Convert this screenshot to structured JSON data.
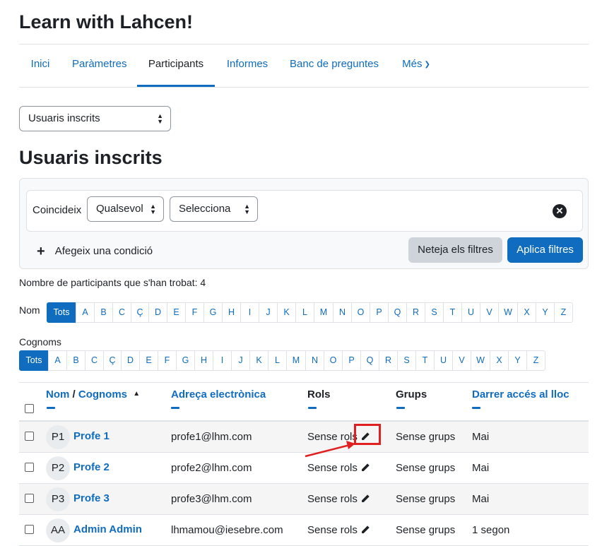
{
  "course_title": "Learn with Lahcen!",
  "nav": {
    "tabs": [
      {
        "label": "Inici"
      },
      {
        "label": "Paràmetres"
      },
      {
        "label": "Participants"
      },
      {
        "label": "Informes"
      },
      {
        "label": "Banc de preguntes"
      },
      {
        "label": "Més"
      }
    ],
    "active": "Participants"
  },
  "view_select": {
    "value": "Usuaris inscrits"
  },
  "page_heading": "Usuaris inscrits",
  "filter": {
    "match_label": "Coincideix",
    "match_value": "Qualsevol",
    "type_value": "Selecciona",
    "add_condition": "Afegeix una condició",
    "clear_button": "Neteja els filtres",
    "apply_button": "Aplica filtres"
  },
  "found_text": "Nombre de participants que s'han trobat: 4",
  "first_name_filter": {
    "label": "Nom",
    "all": "Tots",
    "letters": [
      "A",
      "B",
      "C",
      "Ç",
      "D",
      "E",
      "F",
      "G",
      "H",
      "I",
      "J",
      "K",
      "L",
      "M",
      "N",
      "O",
      "P",
      "Q",
      "R",
      "S",
      "T",
      "U",
      "V",
      "W",
      "X",
      "Y",
      "Z"
    ]
  },
  "last_name_filter": {
    "label": "Cognoms",
    "all": "Tots",
    "letters": [
      "A",
      "B",
      "C",
      "Ç",
      "D",
      "E",
      "F",
      "G",
      "H",
      "I",
      "J",
      "K",
      "L",
      "M",
      "N",
      "O",
      "P",
      "Q",
      "R",
      "S",
      "T",
      "U",
      "V",
      "W",
      "X",
      "Y",
      "Z"
    ]
  },
  "table": {
    "headers": {
      "first_name": "Nom",
      "separator": "/",
      "last_name": "Cognoms",
      "email": "Adreça electrònica",
      "roles": "Rols",
      "groups": "Grups",
      "last_access": "Darrer accés al lloc"
    },
    "rows": [
      {
        "initials": "P1",
        "name": "Profe 1",
        "email": "profe1@lhm.com",
        "roles": "Sense rols",
        "groups": "Sense grups",
        "last_access": "Mai"
      },
      {
        "initials": "P2",
        "name": "Profe 2",
        "email": "profe2@lhm.com",
        "roles": "Sense rols",
        "groups": "Sense grups",
        "last_access": "Mai"
      },
      {
        "initials": "P3",
        "name": "Profe 3",
        "email": "profe3@lhm.com",
        "roles": "Sense rols",
        "groups": "Sense grups",
        "last_access": "Mai"
      },
      {
        "initials": "AA",
        "name": "Admin Admin",
        "email": "lhmamou@iesebre.com",
        "roles": "Sense rols",
        "groups": "Sense grups",
        "last_access": "1 segon"
      }
    ]
  },
  "colors": {
    "accent": "#0f6cbf",
    "annotation": "#e02020"
  }
}
